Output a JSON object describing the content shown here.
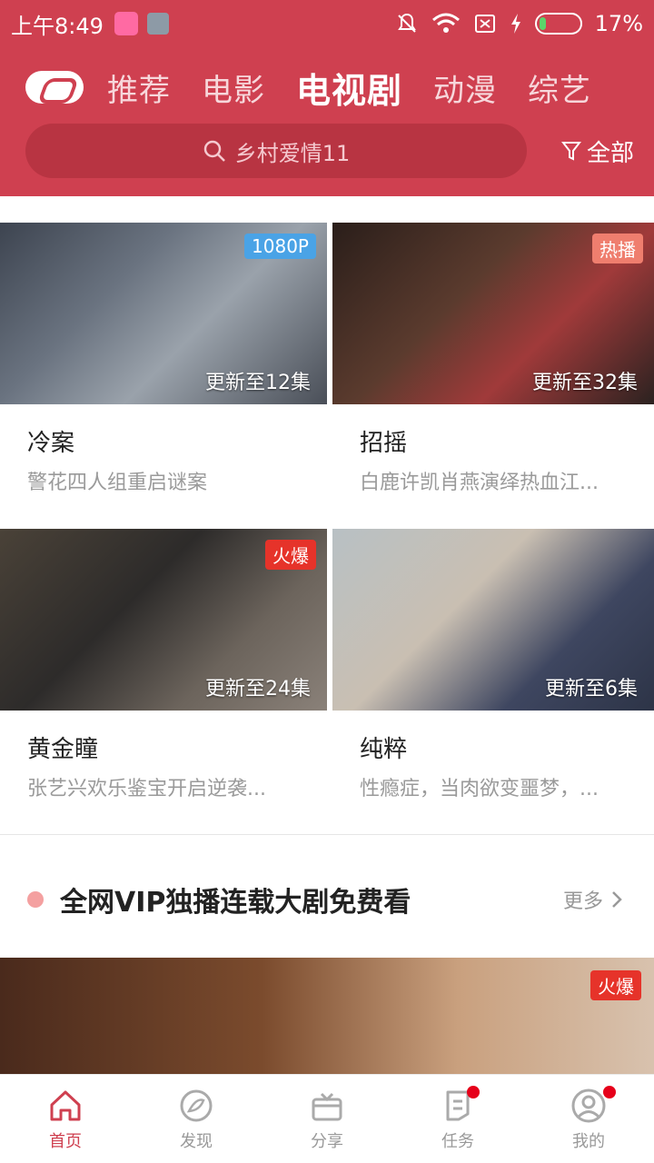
{
  "status_bar": {
    "time": "上午8:49",
    "battery": "17%",
    "battery_level": 0.17
  },
  "header": {
    "tabs": [
      "推荐",
      "电影",
      "电视剧",
      "动漫",
      "综艺"
    ],
    "active_tab": "电视剧",
    "search_text": "乡村爱情11",
    "filter_label": "全部"
  },
  "cards": [
    {
      "title": "冷案",
      "subtitle": "警花四人组重启谜案",
      "update": "更新至12集",
      "badge": "1080P",
      "badge_color": "#4aa3e6"
    },
    {
      "title": "招摇",
      "subtitle": "白鹿许凯肖燕演绎热血江...",
      "update": "更新至32集",
      "badge": "热播",
      "badge_color": "#ef7e6e"
    },
    {
      "title": "黄金瞳",
      "subtitle": "张艺兴欢乐鉴宝开启逆袭...",
      "update": "更新至24集",
      "badge": "火爆",
      "badge_color": "#e6332a"
    },
    {
      "title": "纯粹",
      "subtitle": "性瘾症，当肉欲变噩梦，...",
      "update": "更新至6集",
      "badge": "",
      "badge_color": ""
    }
  ],
  "section": {
    "title": "全网VIP独播连载大剧免费看",
    "more": "更多",
    "banner_badge": "火爆"
  },
  "bottom_nav": [
    {
      "label": "首页",
      "icon": "home-icon",
      "active": true,
      "dot": false
    },
    {
      "label": "发现",
      "icon": "compass-icon",
      "active": false,
      "dot": false
    },
    {
      "label": "分享",
      "icon": "gift-icon",
      "active": false,
      "dot": false
    },
    {
      "label": "任务",
      "icon": "task-icon",
      "active": false,
      "dot": true
    },
    {
      "label": "我的",
      "icon": "profile-icon",
      "active": false,
      "dot": true
    }
  ],
  "colors": {
    "brand": "#cf4050",
    "search_bg": "#b83442"
  }
}
